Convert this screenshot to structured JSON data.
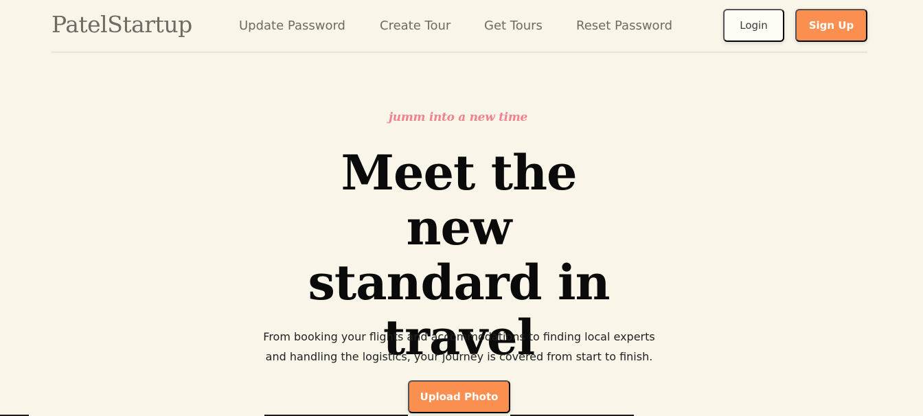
{
  "header": {
    "brand": "PatelStartup",
    "nav": [
      {
        "label": "Update Password"
      },
      {
        "label": "Create Tour"
      },
      {
        "label": "Get Tours"
      },
      {
        "label": "Reset Password"
      }
    ],
    "login_label": "Login",
    "signup_label": "Sign Up"
  },
  "hero": {
    "tagline": "jumm into a new time",
    "headline": "Meet the new standard in travel",
    "subtext": "From booking your flights and accommodations to finding local experts and handling the logistics, your journey is covered from start to finish.",
    "upload_label": "Upload Photo"
  },
  "colors": {
    "background": "#faf5e9",
    "accent": "#fb8f4f",
    "tagline": "#f0838f",
    "nav_text": "#6f6a62",
    "headline": "#0a0a0a"
  }
}
